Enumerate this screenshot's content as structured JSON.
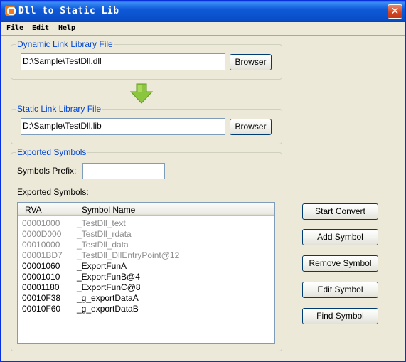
{
  "window": {
    "title": "Dll to Static Lib",
    "close_glyph": "✕"
  },
  "menu": [
    {
      "label": "File"
    },
    {
      "label": "Edit"
    },
    {
      "label": "Help"
    }
  ],
  "dynamic_group": {
    "label": "Dynamic Link Library File",
    "path": "D:\\Sample\\TestDll.dll",
    "browse_label": "Browser"
  },
  "static_group": {
    "label": "Static Link Library File",
    "path": "D:\\Sample\\TestDll.lib",
    "browse_label": "Browser"
  },
  "exported_group": {
    "label": "Exported Symbols",
    "prefix_label": "Symbols Prefix:",
    "prefix_value": "",
    "list_label": "Exported Symbols:",
    "columns": [
      "RVA",
      "Symbol Name"
    ],
    "rows": [
      {
        "rva": "00001000",
        "symbol": "_TestDll_text",
        "dimmed": true
      },
      {
        "rva": "0000D000",
        "symbol": "_TestDll_rdata",
        "dimmed": true
      },
      {
        "rva": "00010000",
        "symbol": "_TestDll_data",
        "dimmed": true
      },
      {
        "rva": "00001BD7",
        "symbol": "_TestDll_DllEntryPoint@12",
        "dimmed": true
      },
      {
        "rva": "00001060",
        "symbol": "_ExportFunA",
        "dimmed": false
      },
      {
        "rva": "00001010",
        "symbol": "_ExportFunB@4",
        "dimmed": false
      },
      {
        "rva": "00001180",
        "symbol": "_ExportFunC@8",
        "dimmed": false
      },
      {
        "rva": "00010F38",
        "symbol": "_g_exportDataA",
        "dimmed": false
      },
      {
        "rva": "00010F60",
        "symbol": "_g_exportDataB",
        "dimmed": false
      }
    ]
  },
  "actions": {
    "start_convert": "Start Convert",
    "add_symbol": "Add Symbol",
    "remove_symbol": "Remove Symbol",
    "edit_symbol": "Edit Symbol",
    "find_symbol": "Find Symbol"
  },
  "colors": {
    "title_bar": "#0a5fe0",
    "group_label": "#0046d5",
    "arrow": "#8cc63f",
    "window_bg": "#ece9d8"
  },
  "icons": {
    "app": "app-logo-icon",
    "arrow": "down-arrow-icon",
    "close": "close-icon"
  }
}
